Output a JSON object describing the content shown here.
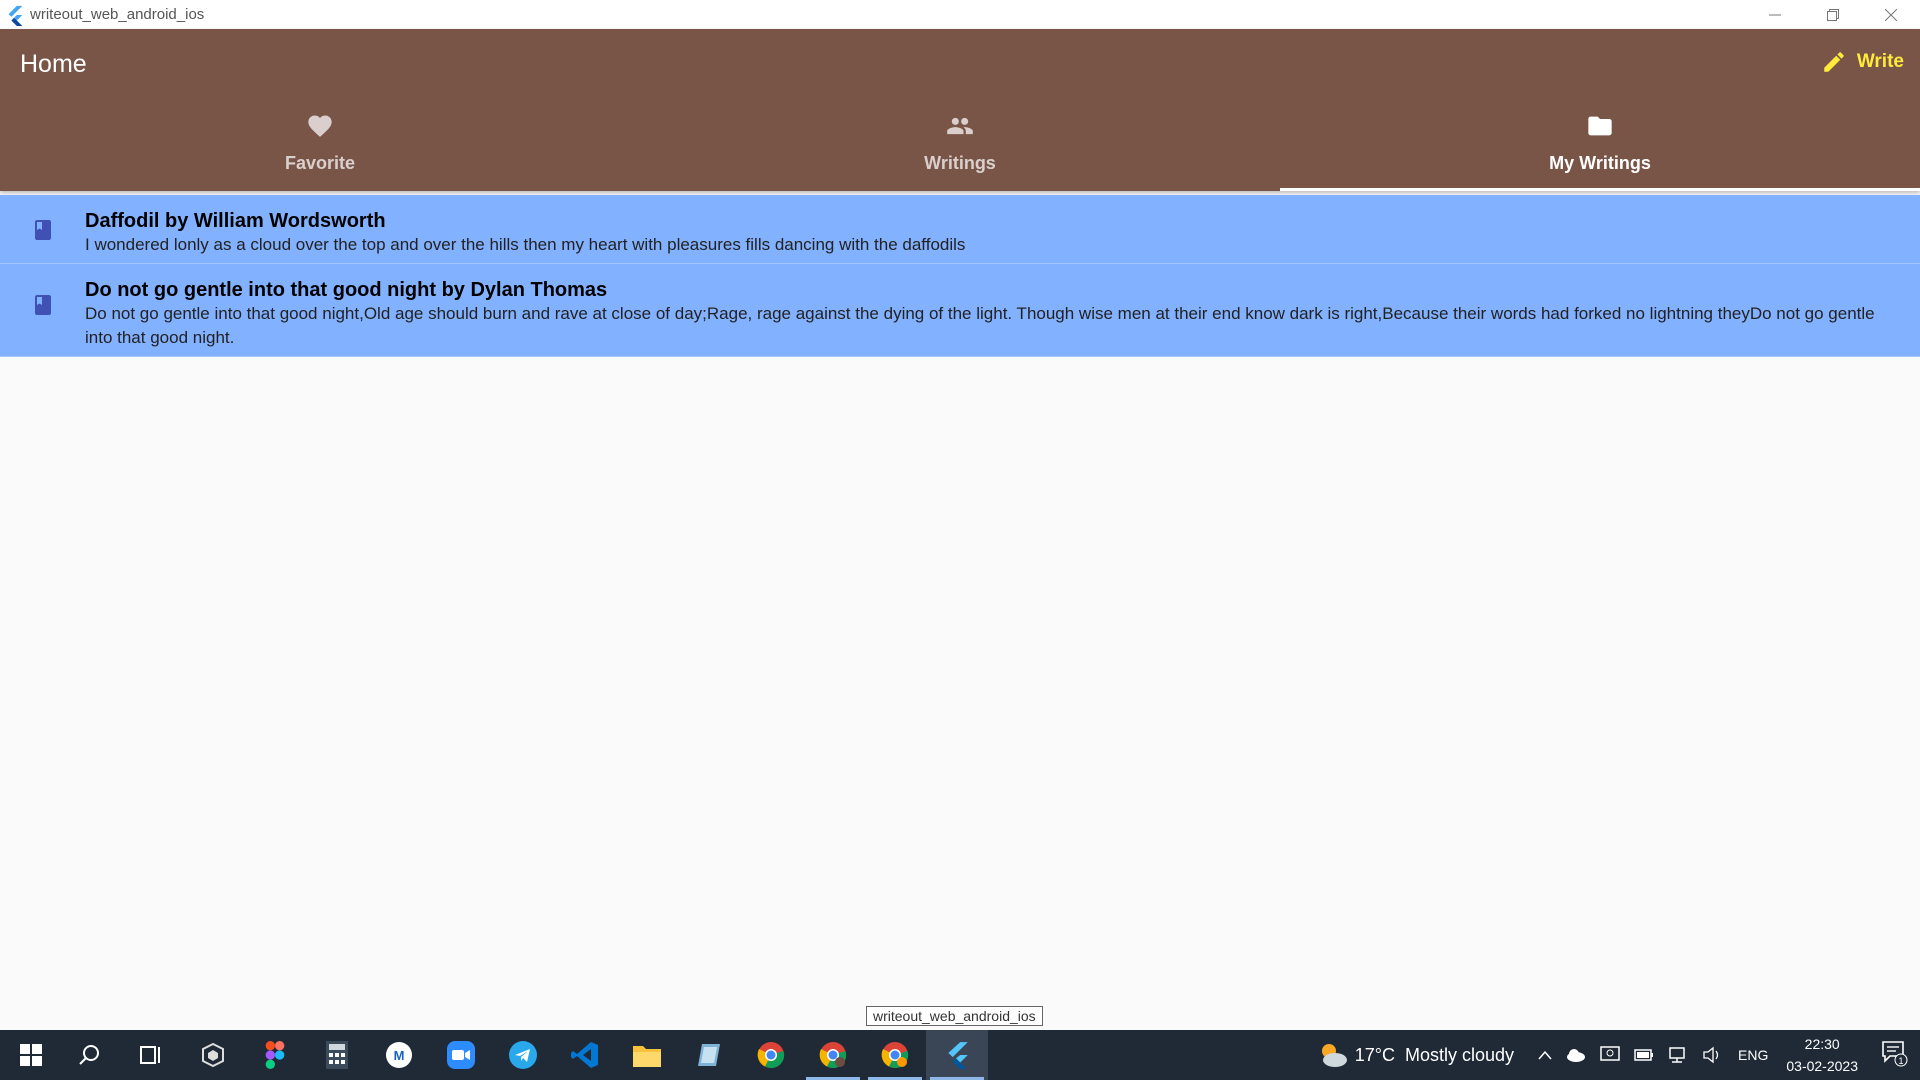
{
  "window": {
    "title": "writeout_web_android_ios"
  },
  "appbar": {
    "title": "Home",
    "write_label": "Write"
  },
  "tabs": [
    {
      "label": "Favorite",
      "icon": "heart-icon",
      "active": false
    },
    {
      "label": "Writings",
      "icon": "people-icon",
      "active": false
    },
    {
      "label": "My Writings",
      "icon": "folder-icon",
      "active": true
    }
  ],
  "writings": [
    {
      "title": "Daffodil by William Wordsworth",
      "excerpt": "I wondered lonly as a cloud over the top and over the hills then my heart with pleasures fills dancing with the daffodils"
    },
    {
      "title": "Do not go gentle into that good night by Dylan Thomas",
      "excerpt": "Do not go gentle into that good night,Old age should burn and rave at close of day;Rage, rage against the dying of the light. Though wise men at their end know dark is right,Because their words had forked no lightning theyDo not go gentle into that good night."
    }
  ],
  "tooltip": "writeout_web_android_ios",
  "taskbar": {
    "weather_temp": "17°C",
    "weather_desc": "Mostly cloudy",
    "lang": "ENG",
    "time": "22:30",
    "date": "03-02-2023",
    "notification_count": "1"
  },
  "colors": {
    "appbar": "#795548",
    "write_accent": "#ffeb3b",
    "list_item_bg": "#82b1ff",
    "book_icon": "#3f51b5"
  }
}
